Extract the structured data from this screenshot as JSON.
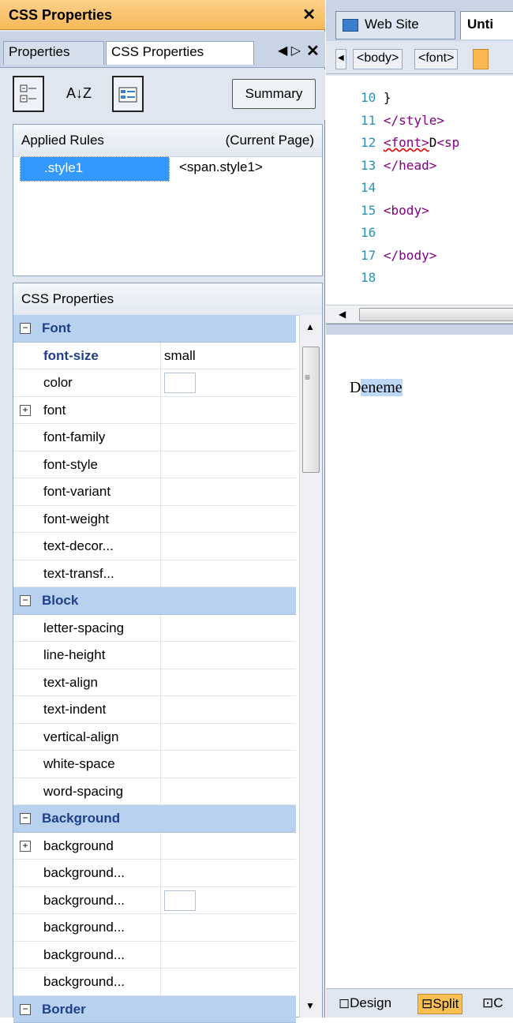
{
  "panel": {
    "title": "CSS Properties",
    "close": "✕",
    "tabs": [
      "Properties",
      "CSS Properties"
    ],
    "tab_nav": "◀ ▷",
    "tab_close": "✕"
  },
  "toolbar": {
    "categorized_icon": "categorized-icon",
    "sort_label": "A↓Z",
    "set_icon": "show-set-properties-icon",
    "summary_label": "Summary"
  },
  "rules": {
    "header_left": "Applied Rules",
    "header_right": "(Current Page)",
    "selector": ".style1",
    "element": "<span.style1>"
  },
  "props": {
    "header": "CSS Properties",
    "rows": [
      {
        "kind": "cat",
        "label": "Font"
      },
      {
        "kind": "prop",
        "label": "font-size",
        "value": "small",
        "bold": true
      },
      {
        "kind": "prop",
        "label": "color",
        "swatch": true
      },
      {
        "kind": "prop",
        "label": "font",
        "expander": true
      },
      {
        "kind": "prop",
        "label": "font-family"
      },
      {
        "kind": "prop",
        "label": "font-style"
      },
      {
        "kind": "prop",
        "label": "font-variant"
      },
      {
        "kind": "prop",
        "label": "font-weight"
      },
      {
        "kind": "prop",
        "label": "text-decor..."
      },
      {
        "kind": "prop",
        "label": "text-transf..."
      },
      {
        "kind": "cat",
        "label": "Block"
      },
      {
        "kind": "prop",
        "label": "letter-spacing"
      },
      {
        "kind": "prop",
        "label": "line-height"
      },
      {
        "kind": "prop",
        "label": "text-align"
      },
      {
        "kind": "prop",
        "label": "text-indent"
      },
      {
        "kind": "prop",
        "label": "vertical-align"
      },
      {
        "kind": "prop",
        "label": "white-space"
      },
      {
        "kind": "prop",
        "label": "word-spacing"
      },
      {
        "kind": "cat",
        "label": "Background"
      },
      {
        "kind": "prop",
        "label": "background",
        "expander": true
      },
      {
        "kind": "prop",
        "label": "background..."
      },
      {
        "kind": "prop",
        "label": "background...",
        "swatch": true
      },
      {
        "kind": "prop",
        "label": "background..."
      },
      {
        "kind": "prop",
        "label": "background..."
      },
      {
        "kind": "prop",
        "label": "background..."
      },
      {
        "kind": "cat",
        "label": "Border"
      }
    ]
  },
  "editor": {
    "tabs": [
      "Web Site",
      "Unti"
    ],
    "crumbs": [
      "<body>",
      "<font>"
    ],
    "code_lines": [
      {
        "n": "10",
        "parts": [
          [
            "txt",
            "}"
          ]
        ]
      },
      {
        "n": "11",
        "parts": [
          [
            "tag",
            "</style>"
          ]
        ]
      },
      {
        "n": "12",
        "parts": [
          [
            "tag",
            "<font>"
          ],
          [
            "txt",
            "D"
          ],
          [
            "tag",
            "<sp"
          ]
        ]
      },
      {
        "n": "13",
        "parts": [
          [
            "tag",
            "</head>"
          ]
        ]
      },
      {
        "n": "14",
        "parts": []
      },
      {
        "n": "15",
        "parts": [
          [
            "tag",
            "<body>"
          ]
        ]
      },
      {
        "n": "16",
        "parts": []
      },
      {
        "n": "17",
        "parts": [
          [
            "tag",
            "</body>"
          ]
        ]
      },
      {
        "n": "18",
        "parts": []
      }
    ],
    "design_first": "D",
    "design_rest": "eneme",
    "views": [
      "Design",
      "Split",
      "C"
    ]
  },
  "colors": {
    "title_bar": "#f7b858",
    "category_row": "#b8d1ee",
    "selection": "#3399ff",
    "code_tag": "#800080",
    "line_number": "#2b91af"
  }
}
